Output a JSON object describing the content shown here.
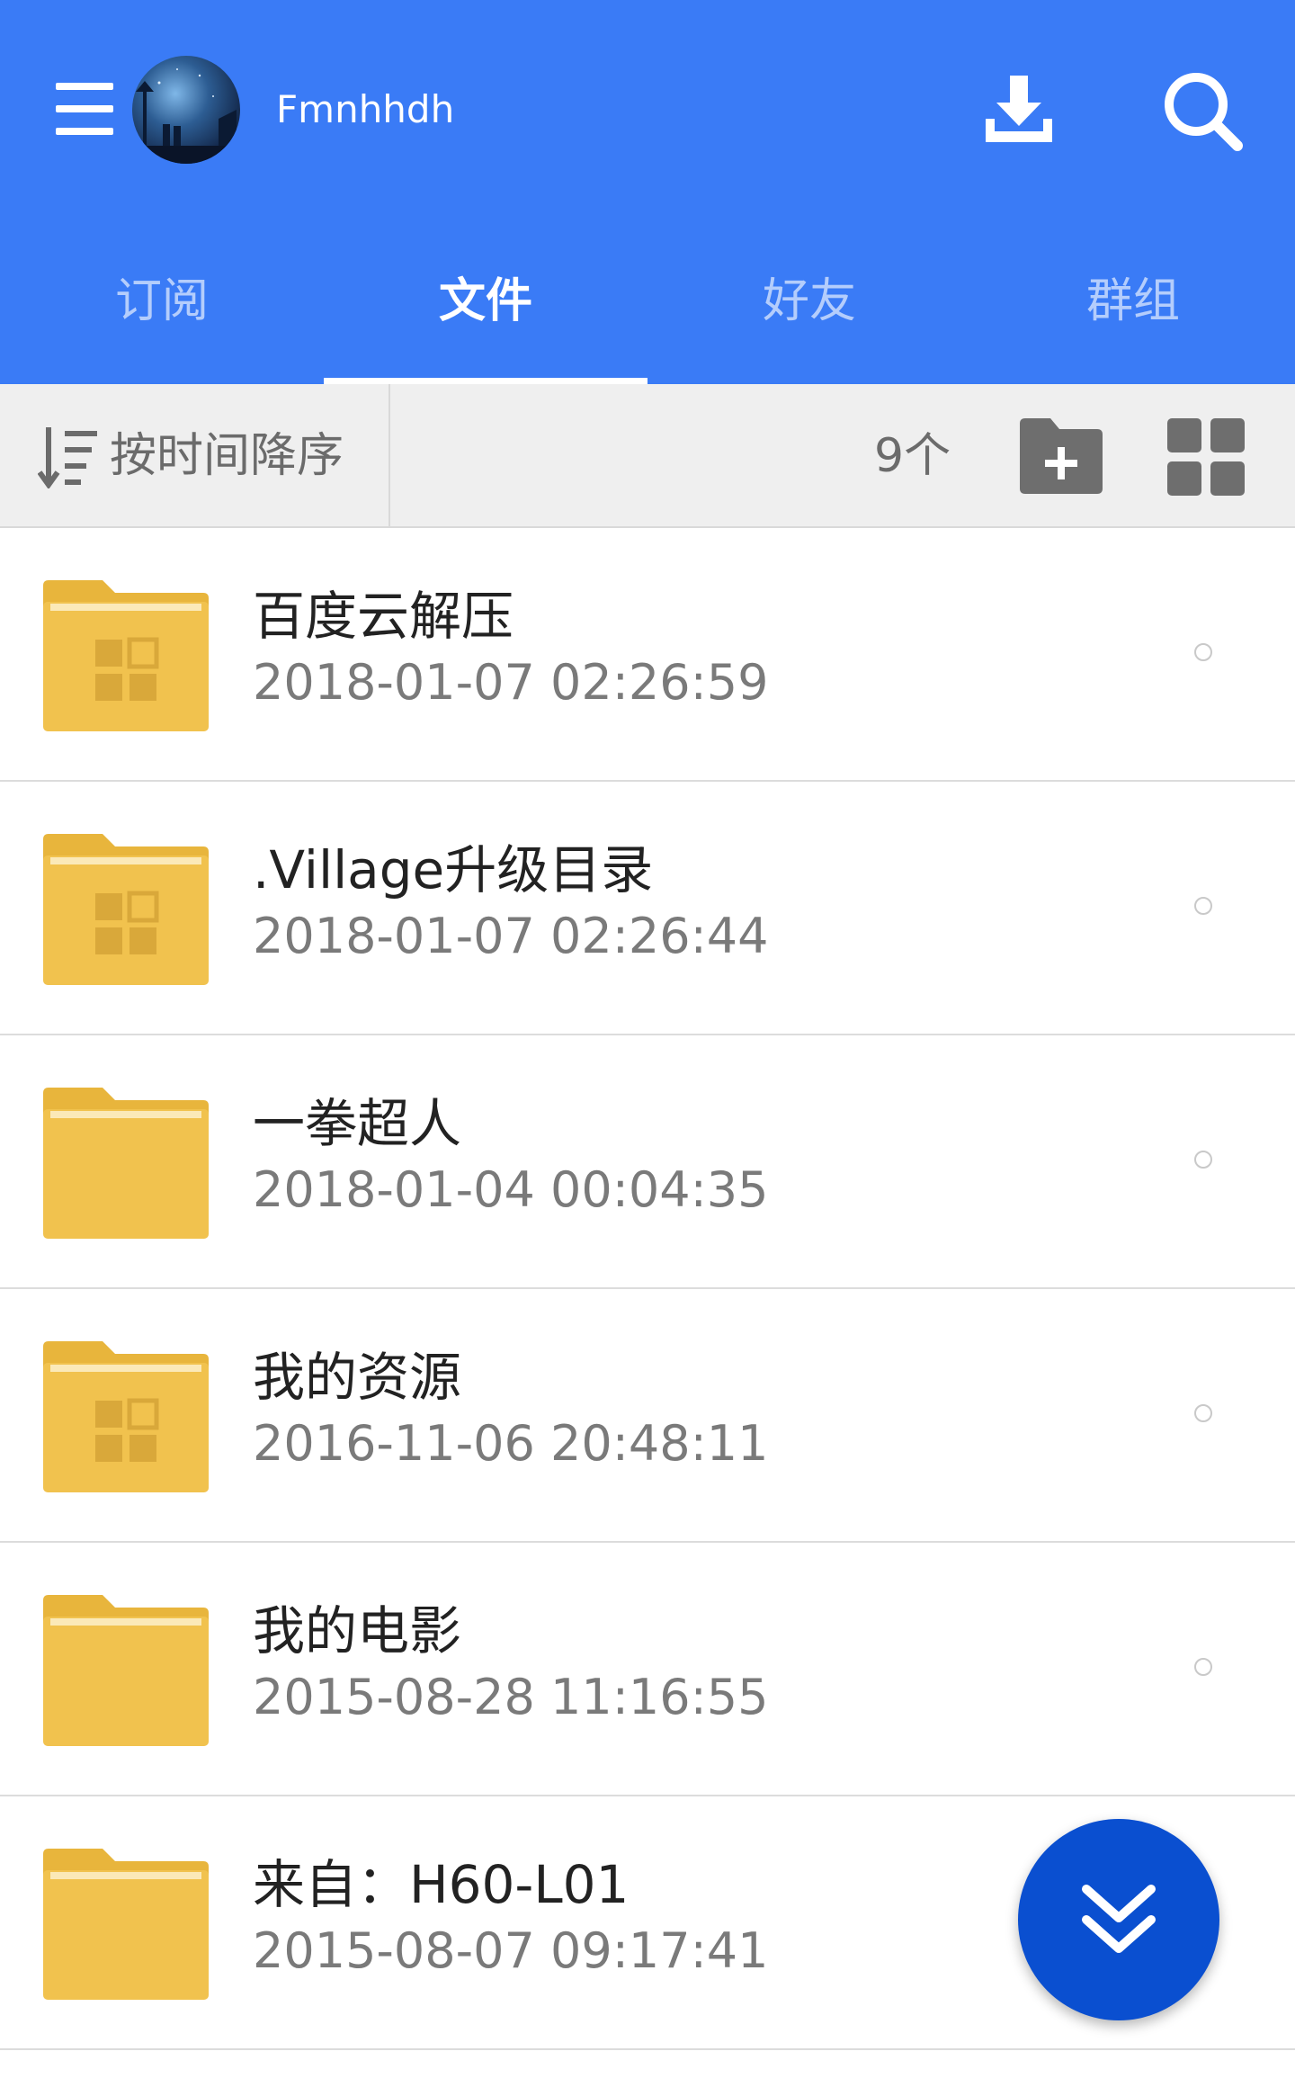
{
  "header": {
    "username": "Fmnhhdh",
    "background_color": "#3a7bf6",
    "menu_icon": "menu-icon",
    "download_icon": "download-icon",
    "search_icon": "search-icon"
  },
  "tabs": [
    {
      "label": "订阅",
      "active": false
    },
    {
      "label": "文件",
      "active": true
    },
    {
      "label": "好友",
      "active": false
    },
    {
      "label": "群组",
      "active": false
    }
  ],
  "toolbar": {
    "sort_label": "按时间降序",
    "count_label": "9个",
    "new_folder_icon": "new-folder-icon",
    "grid_view_icon": "grid-view-icon"
  },
  "files": [
    {
      "name": "百度云解压",
      "date": "2018-01-07 02:26:59",
      "icon": "app-folder-icon"
    },
    {
      "name": ".Village升级目录",
      "date": "2018-01-07 02:26:44",
      "icon": "app-folder-icon"
    },
    {
      "name": "一拳超人",
      "date": "2018-01-04 00:04:35",
      "icon": "folder-icon"
    },
    {
      "name": "我的资源",
      "date": "2016-11-06 20:48:11",
      "icon": "app-folder-icon"
    },
    {
      "name": "我的电影",
      "date": "2015-08-28 11:16:55",
      "icon": "folder-icon"
    },
    {
      "name": "来自：H60-L01",
      "date": "2015-08-07 09:17:41",
      "icon": "folder-icon"
    }
  ],
  "fab": {
    "icon": "double-chevron-down-icon",
    "color": "#0a4fd0"
  },
  "colors": {
    "folder": "#f1c24e",
    "folder_tab": "#e8b53c",
    "text_secondary": "#7a7a7a"
  }
}
